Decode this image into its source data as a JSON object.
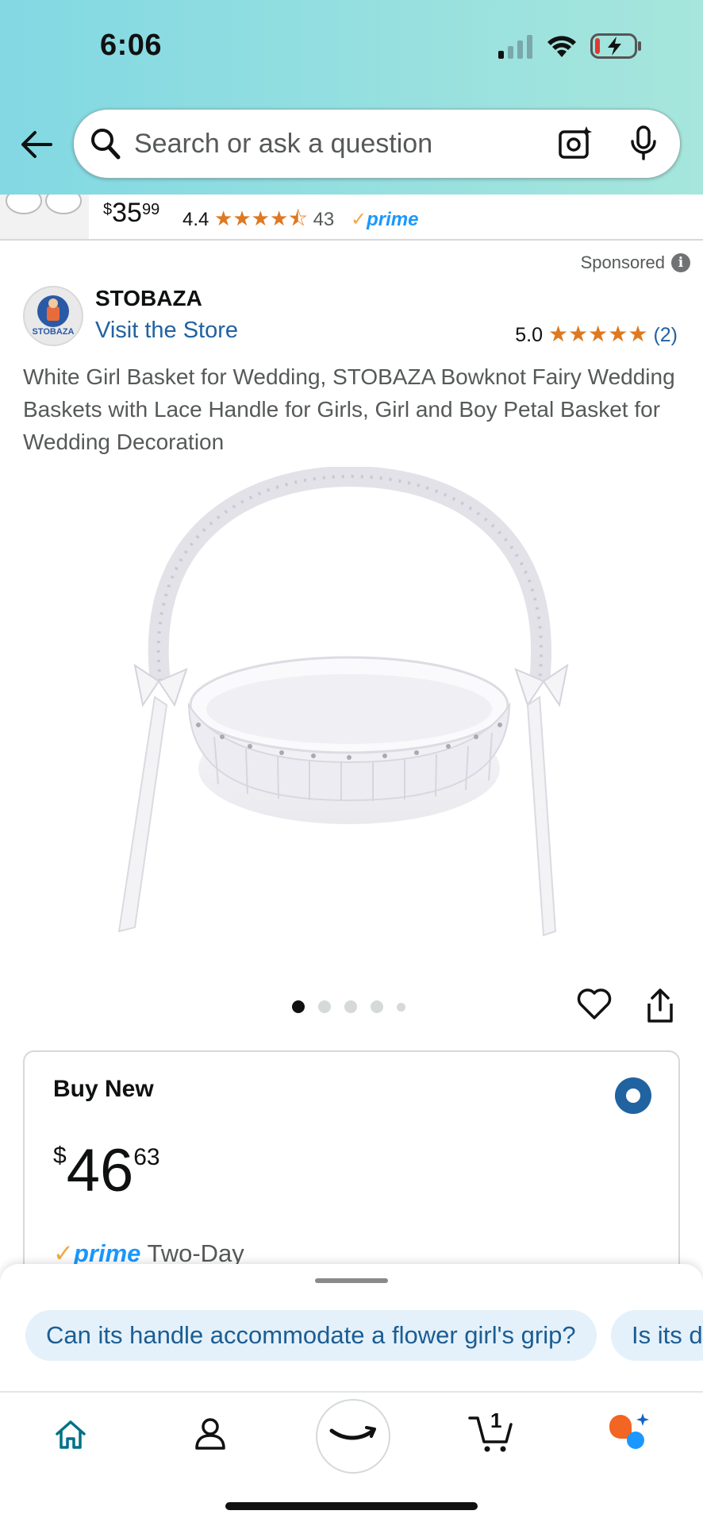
{
  "status_bar": {
    "time": "6:06"
  },
  "search": {
    "placeholder": "Search or ask a question"
  },
  "previous_result": {
    "price_whole": "35",
    "price_fraction": "99",
    "currency": "$",
    "rating": "4.4",
    "stars": "★★★★⯪",
    "review_count": "43",
    "prime_label": "prime"
  },
  "sponsored": {
    "label": "Sponsored"
  },
  "store": {
    "logo_text": "STOBAZA",
    "name": "STOBAZA",
    "visit_label": "Visit the Store",
    "rating": "5.0",
    "stars": "★★★★★",
    "review_count": "(2)"
  },
  "product": {
    "title": "White Girl Basket for Wedding, STOBAZA Bowknot Fairy Wedding Baskets with Lace Handle for Girls, Girl and Boy Petal Basket for Wedding Decoration",
    "image_count": 5,
    "current_image": 1
  },
  "buy_box": {
    "label": "Buy New",
    "selected": true,
    "currency": "$",
    "price_whole": "46",
    "price_fraction": "63",
    "prime_label": "prime",
    "delivery": "Two-Day"
  },
  "questions": [
    "Can its handle accommodate a flower girl's grip?",
    "Is its d"
  ],
  "nav": {
    "items": [
      "home-icon",
      "account-icon",
      "amazon-icon",
      "cart-icon",
      "rufus-icon"
    ],
    "cart_count": "1"
  },
  "colors": {
    "header_start": "#82d8e3",
    "header_end": "#a6e6dc",
    "link": "#2162a1",
    "star": "#de7921",
    "prime_blue": "#1a98ff",
    "chip_bg": "#e4f1fa"
  }
}
